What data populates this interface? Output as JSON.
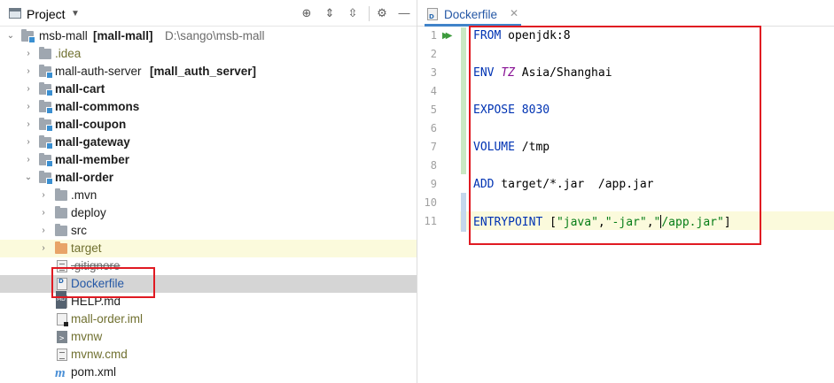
{
  "project_panel": {
    "title": "Project",
    "icons": {
      "window": "project-window-icon",
      "dropdown": "chevron-down-icon",
      "locate": "crosshair-icon",
      "expand": "expand-all-icon",
      "collapse": "collapse-all-icon",
      "settings": "gear-icon",
      "hide": "minimize-icon"
    },
    "tree": {
      "root": {
        "name": "msb-mall",
        "module": "[mall-mall]",
        "path": "D:\\sango\\msb-mall"
      },
      "children": [
        {
          "label": ".idea"
        },
        {
          "label": "mall-auth-server",
          "module": "[mall_auth_server]"
        },
        {
          "label": "mall-cart"
        },
        {
          "label": "mall-commons"
        },
        {
          "label": "mall-coupon"
        },
        {
          "label": "mall-gateway"
        },
        {
          "label": "mall-member"
        },
        {
          "label": "mall-order"
        }
      ],
      "order_children": [
        {
          "label": ".mvn"
        },
        {
          "label": "deploy"
        },
        {
          "label": "src"
        },
        {
          "label": "target"
        },
        {
          "label": ".gitignore"
        },
        {
          "label": "Dockerfile"
        },
        {
          "label": "HELP.md"
        },
        {
          "label": "mall-order.iml"
        },
        {
          "label": "mvnw"
        },
        {
          "label": "mvnw.cmd"
        },
        {
          "label": "pom.xml"
        }
      ]
    }
  },
  "editor": {
    "tab": {
      "label": "Dockerfile",
      "close": "✕"
    },
    "line_numbers": [
      "1",
      "2",
      "3",
      "4",
      "5",
      "6",
      "7",
      "8",
      "9",
      "10",
      "11"
    ],
    "lines": {
      "l1": {
        "kw": "FROM",
        "rest": " openjdk:8"
      },
      "l3": {
        "kw": "ENV",
        "var": "TZ",
        "rest": " Asia/Shanghai"
      },
      "l5": {
        "kw": "EXPOSE",
        "rest": " 8030"
      },
      "l7": {
        "kw": "VOLUME",
        "rest": " /tmp"
      },
      "l9": {
        "kw": "ADD",
        "rest": " target/*.jar  /app.jar"
      },
      "l11": {
        "kw": "ENTRYPOINT",
        "open": " [",
        "s1": "\"java\"",
        "c1": ",",
        "s2": "\"-jar\"",
        "c2": ",",
        "s3a": "\"",
        "s3b": "/app.jar\"",
        "close": "]"
      }
    },
    "highlight_colors": {
      "keyword": "#0033b3",
      "string": "#067d17",
      "env_var": "#871094",
      "annotation_box": "#e01a22"
    }
  }
}
